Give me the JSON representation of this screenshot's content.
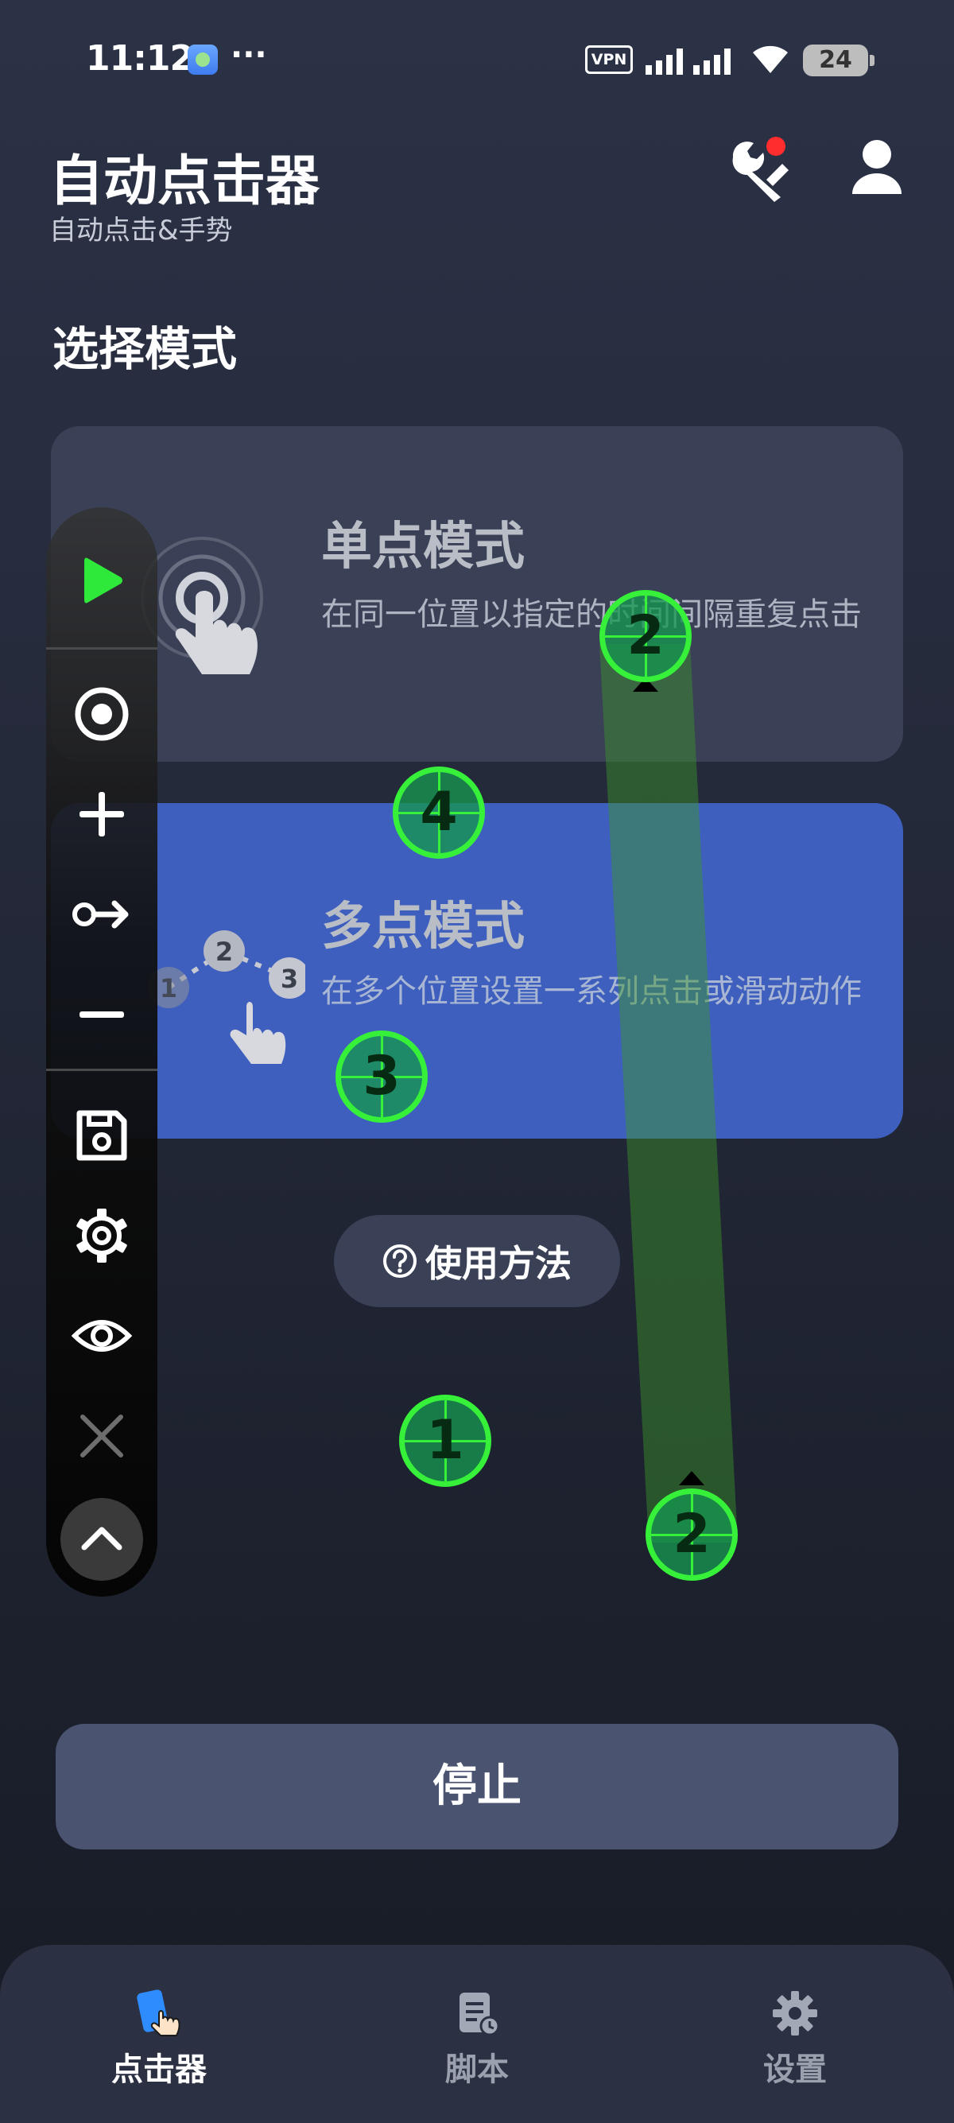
{
  "status_bar": {
    "time": "11:12",
    "dots": "···",
    "vpn": "VPN",
    "battery": "24"
  },
  "header": {
    "title": "自动点击器",
    "subtitle": "自动点击&手势"
  },
  "section_title": "选择模式",
  "modes": {
    "single": {
      "title": "单点模式",
      "description": "在同一位置以指定的时间间隔重复点击"
    },
    "multi": {
      "title": "多点模式",
      "description": "在多个位置设置一系列点击或滑动动作"
    },
    "multi_steps": [
      "1",
      "2",
      "3"
    ]
  },
  "help_button": "使用方法",
  "stop_button": "停止",
  "bottom_nav": [
    {
      "label": "点击器",
      "icon": "clicker-icon",
      "active": true
    },
    {
      "label": "脚本",
      "icon": "script-icon",
      "active": false
    },
    {
      "label": "设置",
      "icon": "settings-icon",
      "active": false
    }
  ],
  "overlay_targets": [
    {
      "label": "1"
    },
    {
      "label": "2"
    },
    {
      "label": "2"
    },
    {
      "label": "3"
    },
    {
      "label": "4"
    }
  ],
  "colors": {
    "accent_green": "#36f03a",
    "multi_card": "#3e5fbe",
    "single_card": "#3a4156",
    "badge_red": "#ff2d2d"
  }
}
